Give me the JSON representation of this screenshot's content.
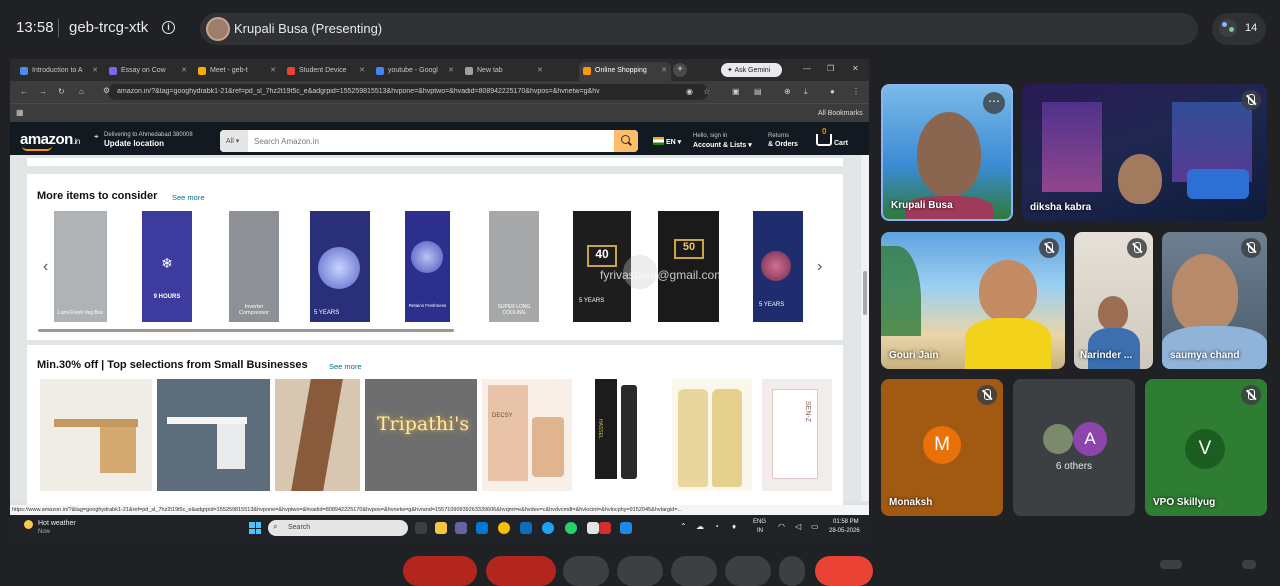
{
  "meet": {
    "time": "13:58",
    "meeting_code": "geb-trcg-xtk",
    "presenter_label": "Krupali Busa (Presenting)",
    "participant_count": "14",
    "accent": "#8ab4f8"
  },
  "browser": {
    "tabs": [
      {
        "label": "Introduction to A",
        "color": "#4a8fe7"
      },
      {
        "label": "Essay on Cow",
        "color": "#7b68ee"
      },
      {
        "label": "Meet - geb-t",
        "color": "#f9ab00"
      },
      {
        "label": "Student Device",
        "color": "#ea4335"
      },
      {
        "label": "youtube - Googl",
        "color": "#4285f4"
      },
      {
        "label": "New tab",
        "color": "#9aa0a6"
      },
      {
        "label": "Online Shopping",
        "color": "#ff9900"
      }
    ],
    "gemini_label": "Ask Gemini",
    "url": "amazon.in/?&tag=googhydrabk1-21&ref=pd_sl_7hz2t19t5c_e&adgrpid=155259815513&hvpone=&hvptwo=&hvadid=808942225170&hvpos=&hvnetw=g&hv",
    "all_bookmarks": "All Bookmarks",
    "status_url": "https://www.amazon.in/?&tag=googhydrabk1-21&ref=pd_sl_7hz2t19t5c_e&adgrpid=155259815513&hvpone=&hvptwo=&hvadid=808942225170&hvpos=&hvnetw=g&hvrand=15571090939263339606&hvqmt=e&hvdev=c&hvdvcmdl=&hvlocint=&hvlocphy=9152045&hvtargid=..."
  },
  "amazon": {
    "logo": "amazon",
    "logo_suffix": ".in",
    "deliver_line1": "Delivering to Ahmedabad 380008",
    "deliver_line2": "Update location",
    "search_dept": "All",
    "search_placeholder": "Search Amazon.in",
    "lang": "EN",
    "account_line1": "Hello, sign in",
    "account_line2": "Account & Lists",
    "returns_line1": "Returns",
    "returns_line2": "& Orders",
    "cart_count": "0",
    "cart_label": "Cart",
    "section1": {
      "title": "More items to consider",
      "see_more": "See more",
      "products": [
        {
          "caption": "Lumi Fresh Veg Box",
          "color": "#b0b3b6"
        },
        {
          "caption": "9 HOURS",
          "color": "#3d3b9e"
        },
        {
          "caption": "Inverter Compressor",
          "color": "#8d9094"
        },
        {
          "caption": "5 YEARS",
          "color": "#2a2f7a"
        },
        {
          "caption": "Retains Freshness",
          "color": "#2d2f8f"
        },
        {
          "caption": "SUPER LONG COOLING",
          "color": "#a6a8aa"
        },
        {
          "caption": "5 YEARS",
          "color": "#1d1d1d"
        },
        {
          "caption": "50",
          "color": "#1a1a1a"
        },
        {
          "caption": "5 YEARS",
          "color": "#1f2d6e"
        }
      ]
    },
    "section2": {
      "title": "Min.30% off | Top selections from Small Businesses",
      "see_more": "See more",
      "products": [
        {
          "caption": "",
          "color": "#c49a62"
        },
        {
          "caption": "",
          "color": "#e9eaec"
        },
        {
          "caption": "",
          "color": "#8a5a3c"
        },
        {
          "caption": "Tripathi's",
          "color": "#6e6e6e"
        },
        {
          "caption": "DECSY",
          "color": "#e8c3a8"
        },
        {
          "caption": "HASSEL",
          "color": "#1c1c1c"
        },
        {
          "caption": "",
          "color": "#e8d79c"
        },
        {
          "caption": "SEN-Z",
          "color": "#f2eceb"
        }
      ]
    }
  },
  "watermark": "fyrivastava@gmail.com",
  "taskbar": {
    "weather_title": "Hot weather",
    "weather_sub": "Now",
    "search_placeholder": "Search",
    "lang1": "ENG",
    "lang2": "IN",
    "time": "01:58 PM",
    "date": "28-05-2026"
  },
  "participants": [
    {
      "name": "Krupali Busa",
      "bg": "#3b8bd4"
    },
    {
      "name": "diksha kabra",
      "bg": "#1f2750"
    },
    {
      "name": "Gouri Jain",
      "bg": "#6fa8d6"
    },
    {
      "name": "Narinder ...",
      "bg": "#d9d4cc"
    },
    {
      "name": "saumya chand",
      "bg": "#5b6e80"
    },
    {
      "name": "Monaksh",
      "initial": "M",
      "bg": "#a25a12",
      "avatar_bg": "#e8710a"
    },
    {
      "name": "6 others",
      "initial": "A",
      "bg": "#3c4043",
      "avatar_bg": "#8e44ad"
    },
    {
      "name": "VPO Skillyug",
      "initial": "V",
      "bg": "#2e7d32",
      "avatar_bg": "#1b5e20"
    }
  ]
}
